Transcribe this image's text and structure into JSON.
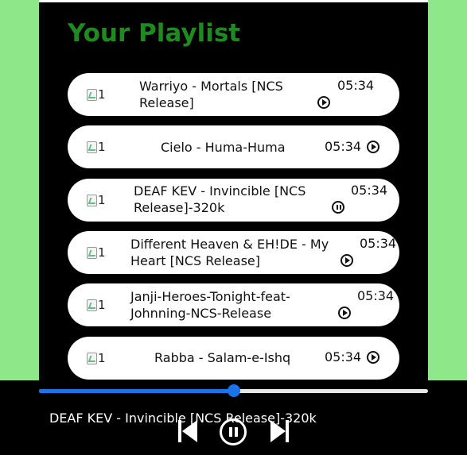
{
  "playlist": {
    "title": "Your Playlist",
    "songs": [
      {
        "image_alt": "1",
        "name": "Warriyo - Mortals [NCS Release]",
        "duration": "05:34",
        "icon": "play-circle-icon"
      },
      {
        "image_alt": "1",
        "name": "Cielo - Huma-Huma",
        "duration": "05:34",
        "icon": "play-circle-icon"
      },
      {
        "image_alt": "1",
        "name": "DEAF KEV - Invincible [NCS Release]-320k",
        "duration": "05:34",
        "icon": "pause-circle-icon"
      },
      {
        "image_alt": "1",
        "name": "Different Heaven & EH!DE - My Heart [NCS Release]",
        "duration": "05:34",
        "icon": "play-circle-icon"
      },
      {
        "image_alt": "1",
        "name": "Janji-Heroes-Tonight-feat-Johnning-NCS-Release",
        "duration": "05:34",
        "icon": "play-circle-icon"
      },
      {
        "image_alt": "1",
        "name": "Rabba - Salam-e-Ishq",
        "duration": "05:34",
        "icon": "play-circle-icon"
      }
    ]
  },
  "player": {
    "now_playing": "DEAF KEV - Invincible [NCS Release]-320k",
    "progress_fraction": 0.5,
    "controls": [
      "previous-icon",
      "pause-circle-icon",
      "next-icon"
    ]
  },
  "colors": {
    "side_panels": "#8ee88a",
    "title": "#1f8a1f",
    "progress": "#1a73e8",
    "background": "#000000"
  }
}
